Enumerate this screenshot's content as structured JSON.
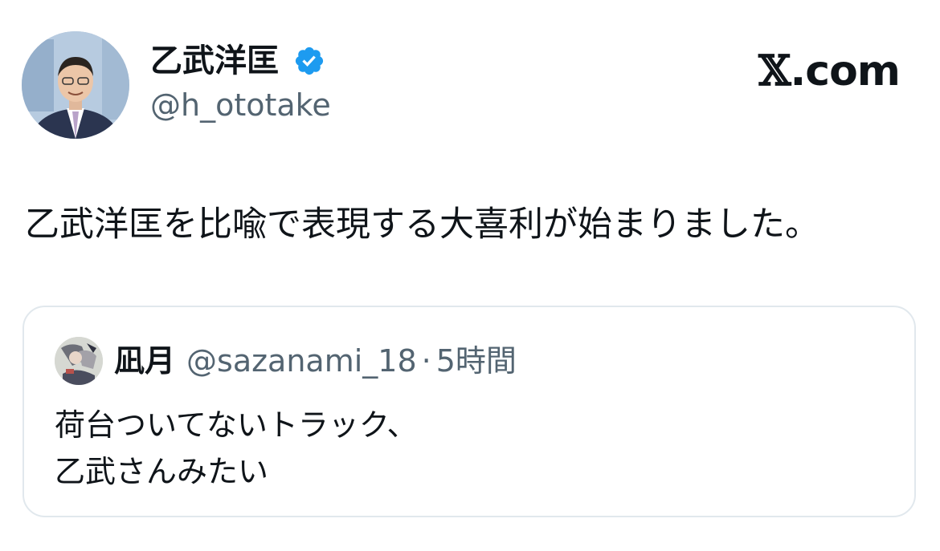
{
  "author": {
    "display_name": "乙武洋匡",
    "handle": "@h_ototake",
    "verified": true,
    "verified_color": "#1d9bf0"
  },
  "brand": {
    "x_letter": "𝕏",
    "domain_text": ".com"
  },
  "tweet": {
    "text": "乙武洋匡を比喩で表現する大喜利が始まりました。"
  },
  "quoted_tweet": {
    "display_name": "凪月",
    "handle": "@sazanami_18",
    "separator": "·",
    "time": "5時間",
    "lines": [
      "荷台ついてないトラック、",
      "乙武さんみたい"
    ]
  },
  "colors": {
    "text_primary": "#0f1419",
    "text_secondary": "#536471",
    "border": "#e1e8ed"
  }
}
